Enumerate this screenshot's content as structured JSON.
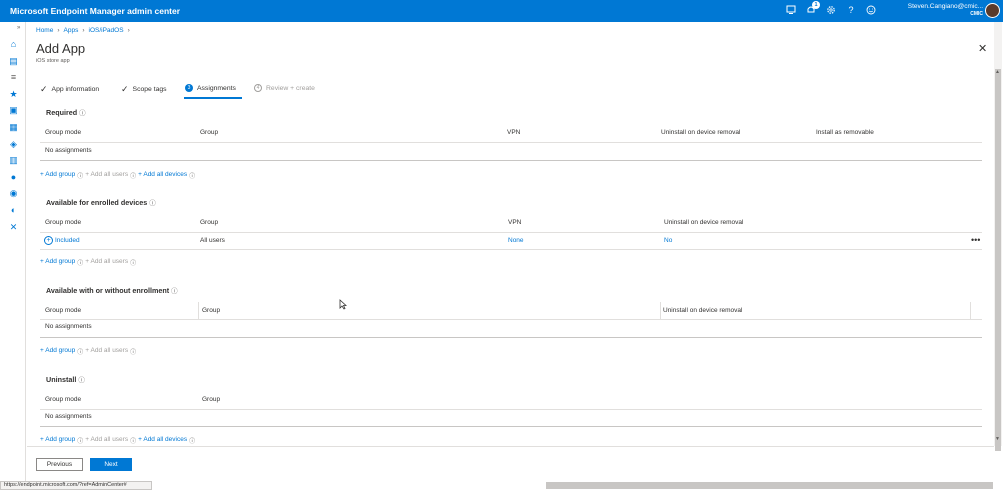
{
  "app": {
    "title": "Microsoft Endpoint Manager admin center",
    "user_name": "Steven.Cangiano@cmic...",
    "tenant": "CMIC",
    "notification_count": "1"
  },
  "topbar_icons": [
    "remote-icon",
    "notification-icon",
    "settings-icon",
    "help-icon",
    "feedback-icon"
  ],
  "sidebar": {
    "items": [
      "home-icon",
      "dashboard-icon",
      "all-services-icon",
      "favorites-icon",
      "devices-icon",
      "apps-icon",
      "endpoint-security-icon",
      "reports-icon",
      "users-icon",
      "groups-icon",
      "tenant-admin-icon",
      "troubleshooting-icon"
    ]
  },
  "breadcrumb": [
    "Home",
    "Apps",
    "iOS/iPadOS"
  ],
  "page": {
    "title": "Add App",
    "subtitle": "iOS store app"
  },
  "tabs": [
    {
      "label": "App information",
      "state": "done"
    },
    {
      "label": "Scope tags",
      "state": "done"
    },
    {
      "label": "Assignments",
      "state": "active",
      "num": "3"
    },
    {
      "label": "Review + create",
      "state": "disabled",
      "num": "4"
    }
  ],
  "sections": {
    "required": {
      "title": "Required",
      "headers": [
        "Group mode",
        "Group",
        "VPN",
        "Uninstall on device removal",
        "Install as removable"
      ],
      "empty": "No assignments",
      "links": [
        "+ Add group",
        "+ Add all users",
        "+ Add all devices"
      ]
    },
    "enrolled": {
      "title": "Available for enrolled devices",
      "headers": [
        "Group mode",
        "Group",
        "VPN",
        "Uninstall on device removal"
      ],
      "row": {
        "mode": "Included",
        "group": "All users",
        "vpn": "None",
        "uninstall": "No"
      },
      "links": [
        "+ Add group",
        "+ Add all users"
      ]
    },
    "without": {
      "title": "Available with or without enrollment",
      "headers": [
        "Group mode",
        "Group",
        "Uninstall on device removal"
      ],
      "empty": "No assignments",
      "links": [
        "+ Add group",
        "+ Add all users"
      ]
    },
    "uninstall": {
      "title": "Uninstall",
      "headers": [
        "Group mode",
        "Group"
      ],
      "empty": "No assignments",
      "links": [
        "+ Add group",
        "+ Add all users",
        "+ Add all devices"
      ]
    }
  },
  "footer": {
    "previous": "Previous",
    "next": "Next"
  },
  "status_url": "https://endpoint.microsoft.com/?ref=AdminCenter#",
  "colors": {
    "accent": "#0078d4",
    "text": "#323130",
    "muted": "#a19f9d"
  }
}
